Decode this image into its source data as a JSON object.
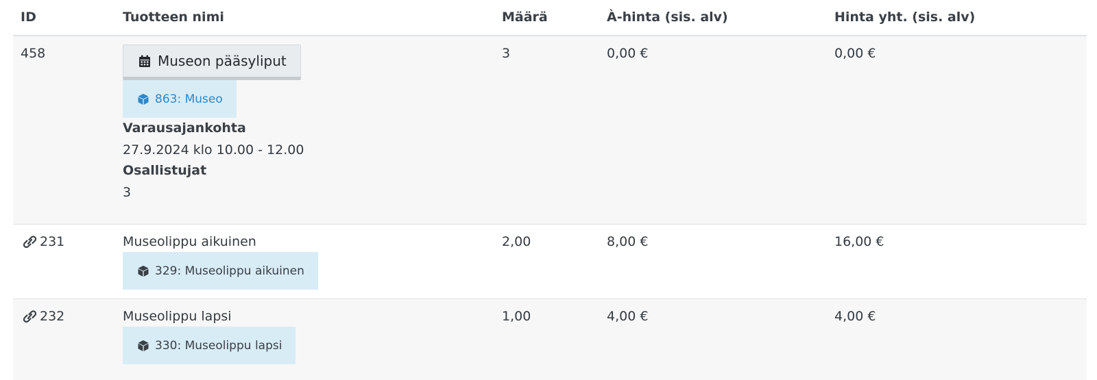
{
  "columns": {
    "id": "ID",
    "name": "Tuotteen nimi",
    "qty": "Määrä",
    "unit_price": "À-hinta (sis. alv)",
    "total_price": "Hinta yht. (sis. alv)"
  },
  "rows": [
    {
      "id": "458",
      "product_button": "Museon pääsyliput",
      "badge": "863: Museo",
      "booking_label": "Varausajankohta",
      "booking_value": "27.9.2024 klo 10.00 - 12.00",
      "participants_label": "Osallistujat",
      "participants_value": "3",
      "qty": "3",
      "unit_price": "0,00 €",
      "total_price": "0,00 €"
    },
    {
      "id": "231",
      "name": "Museolippu aikuinen",
      "badge": "329: Museolippu aikuinen",
      "qty": "2,00",
      "unit_price": "8,00 €",
      "total_price": "16,00 €"
    },
    {
      "id": "232",
      "name": "Museolippu lapsi",
      "badge": "330: Museolippu lapsi",
      "qty": "1,00",
      "unit_price": "4,00 €",
      "total_price": "4,00 €"
    }
  ],
  "icons": {
    "calendar": "calendar-icon",
    "cube": "cube-icon",
    "link": "link-icon"
  },
  "colors": {
    "badge_bg": "#d8ecf5",
    "badge_link": "#2e87c9",
    "row_stripe": "#f7f7f7"
  }
}
